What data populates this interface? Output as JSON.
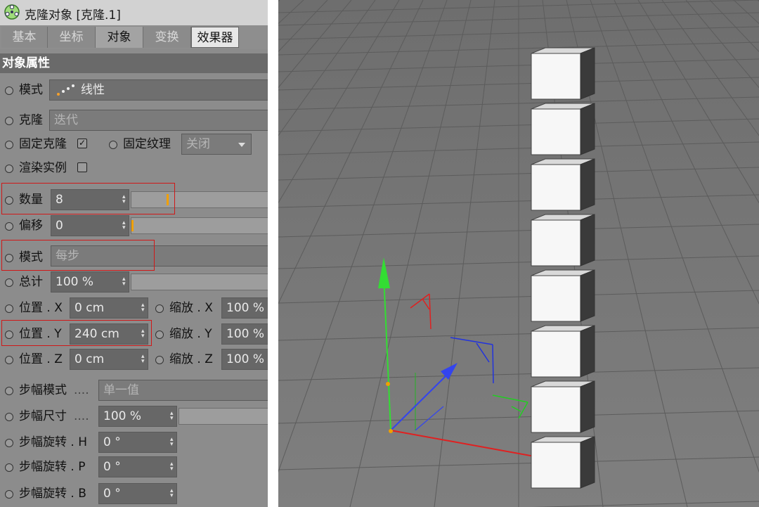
{
  "window": {
    "title": "克隆对象 [克隆.1]"
  },
  "tabs": [
    {
      "label": "基本"
    },
    {
      "label": "坐标"
    },
    {
      "label": "对象"
    },
    {
      "label": "变换"
    },
    {
      "label": "效果器"
    }
  ],
  "section": {
    "title": "对象属性"
  },
  "fields": {
    "mode": {
      "label": "模式",
      "value": "线性"
    },
    "clone": {
      "label": "克隆",
      "value": "迭代"
    },
    "fix_clone": {
      "label": "固定克隆",
      "checked": true
    },
    "fix_texture": {
      "label": "固定纹理",
      "value": "关闭"
    },
    "render_instance": {
      "label": "渲染实例",
      "checked": false
    },
    "count": {
      "label": "数量",
      "value": "8",
      "slider_fraction": 0.25
    },
    "offset": {
      "label": "偏移",
      "value": "0",
      "slider_fraction": 0.0
    },
    "mode2": {
      "label": "模式",
      "value": "每步"
    },
    "total": {
      "label": "总计",
      "value": "100 %"
    },
    "pos_x": {
      "label": "位置 . X",
      "value": "0 cm"
    },
    "pos_y": {
      "label": "位置 . Y",
      "value": "240 cm"
    },
    "pos_z": {
      "label": "位置 . Z",
      "value": "0 cm"
    },
    "scale_x": {
      "label": "缩放 . X",
      "value": "100 %"
    },
    "scale_y": {
      "label": "缩放 . Y",
      "value": "100 %"
    },
    "scale_z": {
      "label": "缩放 . Z",
      "value": "100 %"
    },
    "step_mode": {
      "label": "步幅模式",
      "value": "单一值"
    },
    "step_size": {
      "label": "步幅尺寸",
      "value": "100 %"
    },
    "step_rot_h": {
      "label": "步幅旋转 . H",
      "value": "0 °"
    },
    "step_rot_p": {
      "label": "步幅旋转 . P",
      "value": "0 °"
    },
    "step_rot_b": {
      "label": "步幅旋转 . B",
      "value": "0 °"
    }
  },
  "viewport": {
    "cube_count": 8,
    "colors": {
      "highlight": "#d01818",
      "slider_mark": "#f0a000",
      "axis_x": "#e02020",
      "axis_y": "#22cc22",
      "axis_z": "#2233dd"
    },
    "icons": [
      "cloner-icon",
      "linear-mode-icon",
      "spin-arrows-icon",
      "dropdown-icon"
    ]
  }
}
